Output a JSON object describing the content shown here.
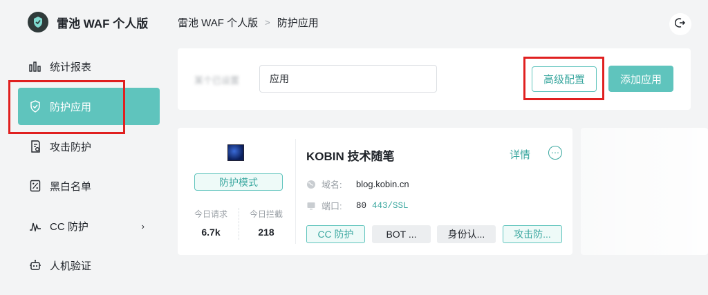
{
  "brand": {
    "title": "雷池 WAF 个人版"
  },
  "sidebar": {
    "items": [
      {
        "label": "统计报表",
        "icon": "bar-chart-icon"
      },
      {
        "label": "防护应用",
        "icon": "shield-icon",
        "active": true
      },
      {
        "label": "攻击防护",
        "icon": "attack-log-icon"
      },
      {
        "label": "黑白名单",
        "icon": "percent-list-icon"
      },
      {
        "label": "CC 防护",
        "icon": "pulse-icon",
        "chevron": "›"
      },
      {
        "label": "人机验证",
        "icon": "robot-icon"
      }
    ]
  },
  "breadcrumb": {
    "root": "雷池 WAF 个人版",
    "sep": ">",
    "current": "防护应用"
  },
  "toolbar": {
    "blur_label": "某个已设置",
    "search_value": "应用",
    "advanced_label": "高级配置",
    "add_label": "添加应用"
  },
  "app_card": {
    "mode": "防护模式",
    "stats": {
      "today_requests_label": "今日请求",
      "today_requests": "6.7k",
      "today_blocked_label": "今日拦截",
      "today_blocked": "218"
    },
    "name": "KOBIN 技术随笔",
    "detail_label": "详情",
    "more_icon": "⋯",
    "domain_label": "域名:",
    "domain": "blog.kobin.cn",
    "port_label": "端口:",
    "port": "80",
    "port_ssl": "443/SSL",
    "tags": [
      "CC 防护",
      "BOT ...",
      "身份认...",
      "攻击防..."
    ]
  },
  "colors": {
    "accent": "#5fc4bd",
    "accent_text": "#3aa79f",
    "highlight": "#e02020"
  }
}
